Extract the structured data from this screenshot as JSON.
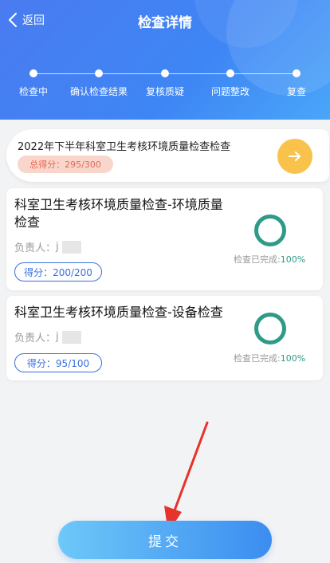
{
  "header": {
    "back_label": "返回",
    "title": "检查详情"
  },
  "steps": [
    {
      "label": "检查中"
    },
    {
      "label": "确认检查结果"
    },
    {
      "label": "复核质疑"
    },
    {
      "label": "问题整改"
    },
    {
      "label": "复查"
    }
  ],
  "summary": {
    "name": "2022年下半年科室卫生考核环境质量检查检查",
    "score": "总得分：295/300"
  },
  "cards": [
    {
      "title": "科室卫生考核环境质量检查-环境质量检查",
      "owner_label": "负责人：",
      "owner_initial": "j",
      "score": "得分：200/200",
      "done_label": "检查已完成:",
      "done_pct": "100%"
    },
    {
      "title": "科室卫生考核环境质量检查-设备检查",
      "owner_label": "负责人：",
      "owner_initial": "j",
      "score": "得分：95/100",
      "done_label": "检查已完成:",
      "done_pct": "100%"
    }
  ],
  "submit_label": "提交",
  "colors": {
    "primary": "#3e86f5",
    "accent_yellow": "#f9c24a",
    "teal": "#2e9a88",
    "score_pink": "#f8d6cc",
    "arrow_red": "#e8322a"
  },
  "icons": {
    "back": "chevron-left-icon",
    "go": "arrow-right-icon",
    "progress": "progress-ring-icon"
  }
}
